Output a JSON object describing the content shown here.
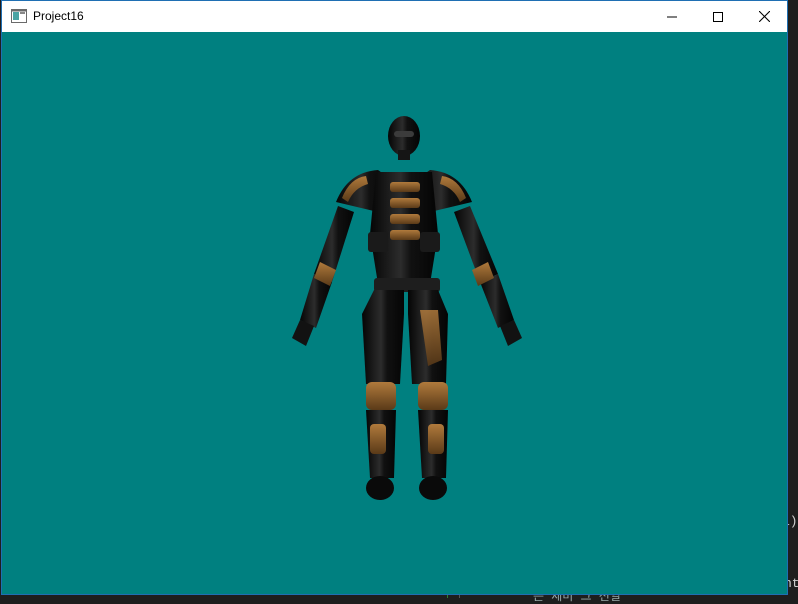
{
  "window": {
    "title": "Project16",
    "controls": {
      "minimize": "minimize-icon",
      "maximize": "maximize-icon",
      "close": "close-icon"
    }
  },
  "viewport": {
    "background_color": "#008080",
    "subject": "armored-soldier-model"
  },
  "background_fragments": {
    "a": "1)",
    "b": "nt",
    "c": "는 세미 그 선일"
  }
}
